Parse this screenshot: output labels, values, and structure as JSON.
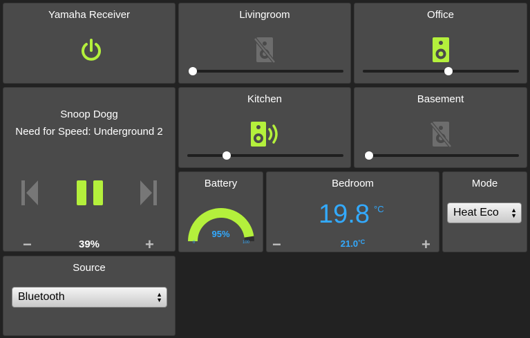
{
  "colors": {
    "accent": "#b4f03c",
    "muted": "#777777",
    "temp": "#33aaff",
    "tile": "#4a4a4a",
    "background": "#222222"
  },
  "yamaha": {
    "title": "Yamaha Receiver",
    "icon": "power-icon",
    "power_on": true
  },
  "livingroom": {
    "title": "Livingroom",
    "icon": "speaker-muted-icon",
    "volume": 0.02
  },
  "office": {
    "title": "Office",
    "icon": "speaker-icon",
    "volume": 0.55
  },
  "player": {
    "artist": "Snoop Dogg",
    "album": "Need for Speed: Underground 2",
    "volume_text": "39%",
    "minus": "−",
    "plus": "+"
  },
  "kitchen": {
    "title": "Kitchen",
    "icon": "speaker-playing-icon",
    "volume": 0.25
  },
  "basement": {
    "title": "Basement",
    "icon": "speaker-muted-icon",
    "volume": 0.03
  },
  "battery": {
    "title": "Battery",
    "value_text": "95%",
    "level": 0.95,
    "min": "0",
    "max": "100"
  },
  "bedroom": {
    "title": "Bedroom",
    "current_temp": "19.8",
    "unit": "°C",
    "setpoint_value": "21.0",
    "setpoint_unit": "°C",
    "minus": "−",
    "plus": "+"
  },
  "mode": {
    "title": "Mode",
    "selected": "Heat Eco"
  },
  "source": {
    "title": "Source",
    "selected": "Bluetooth"
  }
}
